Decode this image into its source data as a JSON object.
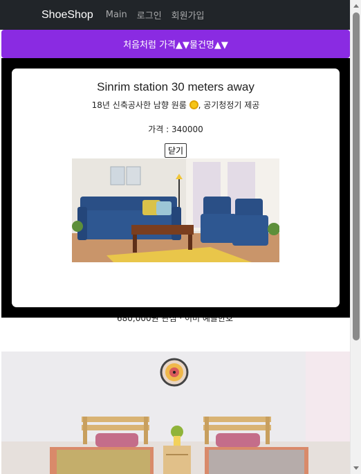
{
  "navbar": {
    "brand": "ShoeShop",
    "links": [
      "Main",
      "로그인",
      "회원가입"
    ]
  },
  "sortbar": {
    "label": "처음처럼 가격▲▼물건명▲▼"
  },
  "modal": {
    "title": "Sinrim station 30 meters away",
    "description_before": "18년 신축공사한 남향 원룸 ",
    "sun_icon": "sun-icon",
    "description_after": ", 공기청정기 제공",
    "price": "가격 : 340000",
    "close_label": "닫기",
    "image": "living-room-sofa-photo"
  },
  "background": {
    "price_text": "680,000원 관심 · 이미 예들한호",
    "image": "bedroom-twin-beds-photo"
  },
  "colors": {
    "navbar": "#212529",
    "sortbar": "#8a2be2",
    "backdrop": "#000000"
  }
}
